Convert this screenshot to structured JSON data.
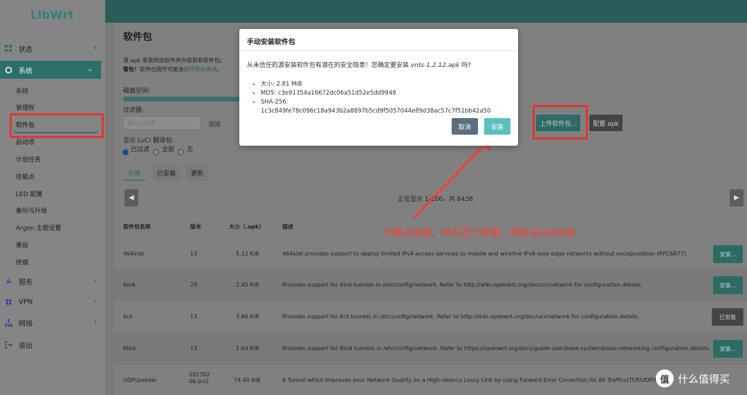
{
  "sidebar": {
    "logo": "LibWrt",
    "status": "状态",
    "system": "系统",
    "sub_items": [
      "系统",
      "管理权",
      "软件包",
      "启动项",
      "计划任务",
      "挂载点",
      "LED 配置",
      "备份与升级",
      "Argon 主题设置",
      "重启",
      "终端"
    ],
    "services": "服务",
    "vpn": "VPN",
    "network": "网络",
    "logout": "退出"
  },
  "page": {
    "title": "软件包",
    "desc_line1": "用 apk 安装附加软件并升级现有软件包。",
    "warning_strong": "警告！",
    "warning_text": "软件包操作可能会",
    "warning_link": "损坏你的系统",
    "warning_end": "。",
    "disk_label": "磁盘空间:",
    "filter_label": "过滤器:",
    "filter_placeholder": "输入以过滤...",
    "clear_label": "清除",
    "translations_label": "显示 LuCI 翻译包:",
    "radio_filtered": "已过滤",
    "radio_all": "全部",
    "radio_none": "无",
    "upload_button": "上传软件包...",
    "config_button": "配置 apk",
    "tabs": [
      "可用",
      "已安装",
      "更新"
    ],
    "showing_text": "正在显示 1-100，共 6438",
    "prev": "◀",
    "next": "▶"
  },
  "table": {
    "headers": [
      "软件包名称",
      "版本",
      "大小（.apk）",
      "描述"
    ],
    "rows": [
      {
        "name": "464xlat",
        "version": "13",
        "size": "5.12 KiB",
        "desc": "464xlat provides support to deploy limited IPv4 access services to mobile and wireline IPv6-only edge networks without encapsulation (RFC6877)",
        "action": "安装..."
      },
      {
        "name": "6in4",
        "version": "29",
        "size": "2.45 KiB",
        "desc": "Provides support for 6in4 tunnels in /etc/config/network. Refer to http://wiki.openwrt.org/doc/uci/network for configuration details.",
        "action": "安装..."
      },
      {
        "name": "6rd",
        "version": "13",
        "size": "3.86 KiB",
        "desc": "Provides support for 6rd tunnels in /etc/config/network. Refer to http://wiki.openwrt.org/doc/uci/network for configuration details.",
        "action": "已安装"
      },
      {
        "name": "6to4",
        "version": "13",
        "size": "1.64 KiB",
        "desc": "Provides support for 6to4 tunnels in /etc/config/network. Refer to https://openwrt.org/docs/guide-user/base-system/basic-networking configuration details.",
        "action": "安装..."
      },
      {
        "name": "UDPspeeder",
        "version": "202302\n06.0-r2",
        "size": "74.40 KiB",
        "desc": "A Tunnel which Improves your Network Quality on a High-latency Lossy Link by using Forward Error Correction,for All Traffics(TCP/UDP/ICMP)",
        "action": ""
      }
    ]
  },
  "modal": {
    "title": "手动安装软件包",
    "warning_prefix": "从未信任的源安装软件包有潜在的安全隐患！您确定要安装 ",
    "file": "vnts-1.2.12.apk",
    "warning_suffix": " 吗?",
    "size_line": "大小: 2.81 MiB",
    "md5_line": "MD5: c3e91354a16672dc06a51d52e5dd9948",
    "sha_label": "SHA-256:",
    "sha_value": "1c3c849fe78c096c18a943b2a8897b5cd9f5057044e89d38ac57c7f51bb42a50",
    "cancel": "取消",
    "install": "安装"
  },
  "annotation": {
    "text": "不要点安装，停在这个界面，然后去ssh终端",
    "color": "#ff3b30"
  },
  "watermark": {
    "logo": "值",
    "text": "什么值得买"
  },
  "colors": {
    "accent": "#2f7f79",
    "install_button": "#5bc0bd",
    "cancel_button": "#5a6f7f",
    "highlight": "#e8342f"
  }
}
